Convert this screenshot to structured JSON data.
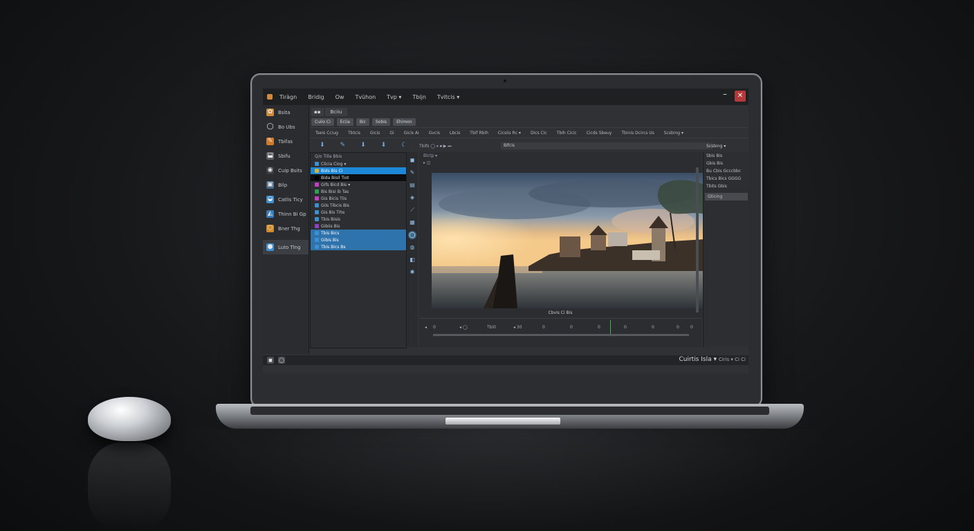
{
  "window": {
    "menu": [
      "Tiràgn",
      "Bridig",
      "Ow",
      "Tvühon",
      "Tvp ▾",
      "Tbijn",
      "Tvitcis ▾"
    ],
    "minimize": "–",
    "close": "✕"
  },
  "left_nav": {
    "items": [
      {
        "label": "Bsita",
        "icon": "✿",
        "color": "#d08a3a"
      },
      {
        "label": "Bo Ubs",
        "icon": "◯",
        "color": "#2d2f33"
      },
      {
        "label": "Tbifas",
        "icon": "✎",
        "color": "#d07a2a"
      },
      {
        "label": "Sbifu",
        "icon": "⬓",
        "color": "#5a5d62"
      },
      {
        "label": "Cuip Bsits",
        "icon": "◉",
        "color": "#3a3c40"
      },
      {
        "label": "Bilp",
        "icon": "▣",
        "color": "#4a6a8a"
      },
      {
        "label": "Catlis Ticy",
        "icon": "◒",
        "color": "#3d8fd0"
      },
      {
        "label": "Thinn Bi Gp",
        "icon": "◭",
        "color": "#3a7cb8"
      },
      {
        "label": "Bner Thg",
        "icon": "⬡",
        "color": "#d08a2a"
      }
    ],
    "active_item": {
      "label": "Luto Tlng",
      "icon": "●",
      "color": "#3d8fd0"
    }
  },
  "tabs": [
    "",
    "Bciiu"
  ],
  "buttons": [
    "Cuiio Ci",
    "Eciia",
    "Bic",
    "Sobis",
    "Ehimon"
  ],
  "toolbar": [
    "Tseis Cciug",
    "Tbtcis",
    "Gicis",
    "Gi",
    "Gicis Ai",
    "Gvcis",
    "Lbcis",
    "Tbif Rbih",
    "Cicsiis Rc ▾",
    "Dics Cic",
    "Tbih Cicic",
    "Cicds Sbeuy",
    "Tbinis Dcircs Us",
    "Scsbing ▾"
  ],
  "icon_row": [
    "⬇",
    "✎",
    "⬇",
    "⬇",
    "☾"
  ],
  "tree": {
    "header": "Q/o Tilla Bbis",
    "rows": [
      {
        "label": "Clicia Ciog ▾",
        "swatch": "#3d8fd0",
        "style": ""
      },
      {
        "label": "Bids Bis Ci",
        "swatch": "#d0b040",
        "style": "sel"
      },
      {
        "label": "Bida Bisil Tiot",
        "swatch": "#000000",
        "style": "dark"
      },
      {
        "label": "Gifs Bicd Bis ▾",
        "swatch": "#c040c0",
        "style": ""
      },
      {
        "label": "Bis Bisi ib Tas",
        "swatch": "#30a050",
        "style": ""
      },
      {
        "label": "Gis Bicis Tiis",
        "swatch": "#c040c0",
        "style": ""
      },
      {
        "label": "Gils Tibcis Bis",
        "swatch": "#3d8fd0",
        "style": ""
      },
      {
        "label": "Gis Bis Tihs",
        "swatch": "#3d8fd0",
        "style": ""
      },
      {
        "label": "Tbis Bisis",
        "swatch": "#3d8fd0",
        "style": ""
      },
      {
        "label": "Gibiis Bis",
        "swatch": "#9040c0",
        "style": ""
      },
      {
        "label": "Tbis Bics",
        "swatch": "#3d8fd0",
        "style": "sel2"
      },
      {
        "label": "Gibis Bis",
        "swatch": "#3d8fd0",
        "style": "sel2"
      },
      {
        "label": "Tbis Bics Bs",
        "swatch": "#3d8fd0",
        "style": "sel2"
      }
    ]
  },
  "tools": [
    "◼",
    "✎",
    "▤",
    "◈",
    "⟋",
    "▦",
    "◯",
    "◍",
    "◧",
    "✱"
  ],
  "viewer": {
    "tab": "Blctp ▾",
    "topbar": "▸ ◫",
    "transport": "Tbifs  ◯  ⏸ ⏹ ▶ ⏭",
    "zoom_field": "Bifcis",
    "caption": "Cbvis Ci Bis",
    "timeline_marks": [
      "◂",
      "0",
      "◂ ◯",
      "Tbi0",
      "◂ 30",
      "0",
      "0",
      "0",
      "0",
      "0",
      "0",
      "0"
    ]
  },
  "right_panel": {
    "dropdown": "Scsbing ▾",
    "rows": [
      "Sbis Bis",
      "Gbis Bis",
      "Bu Cbis Gcccbbc",
      "Tbics Bics GGGG",
      "Tbits Gbis"
    ],
    "highlight": "Gticing"
  },
  "statusbar": {
    "icons": [
      "◼",
      "◯"
    ],
    "right_text": "Cuirtis Isla ▾",
    "right_small": "Ciris  ▾ Ci Ci"
  }
}
